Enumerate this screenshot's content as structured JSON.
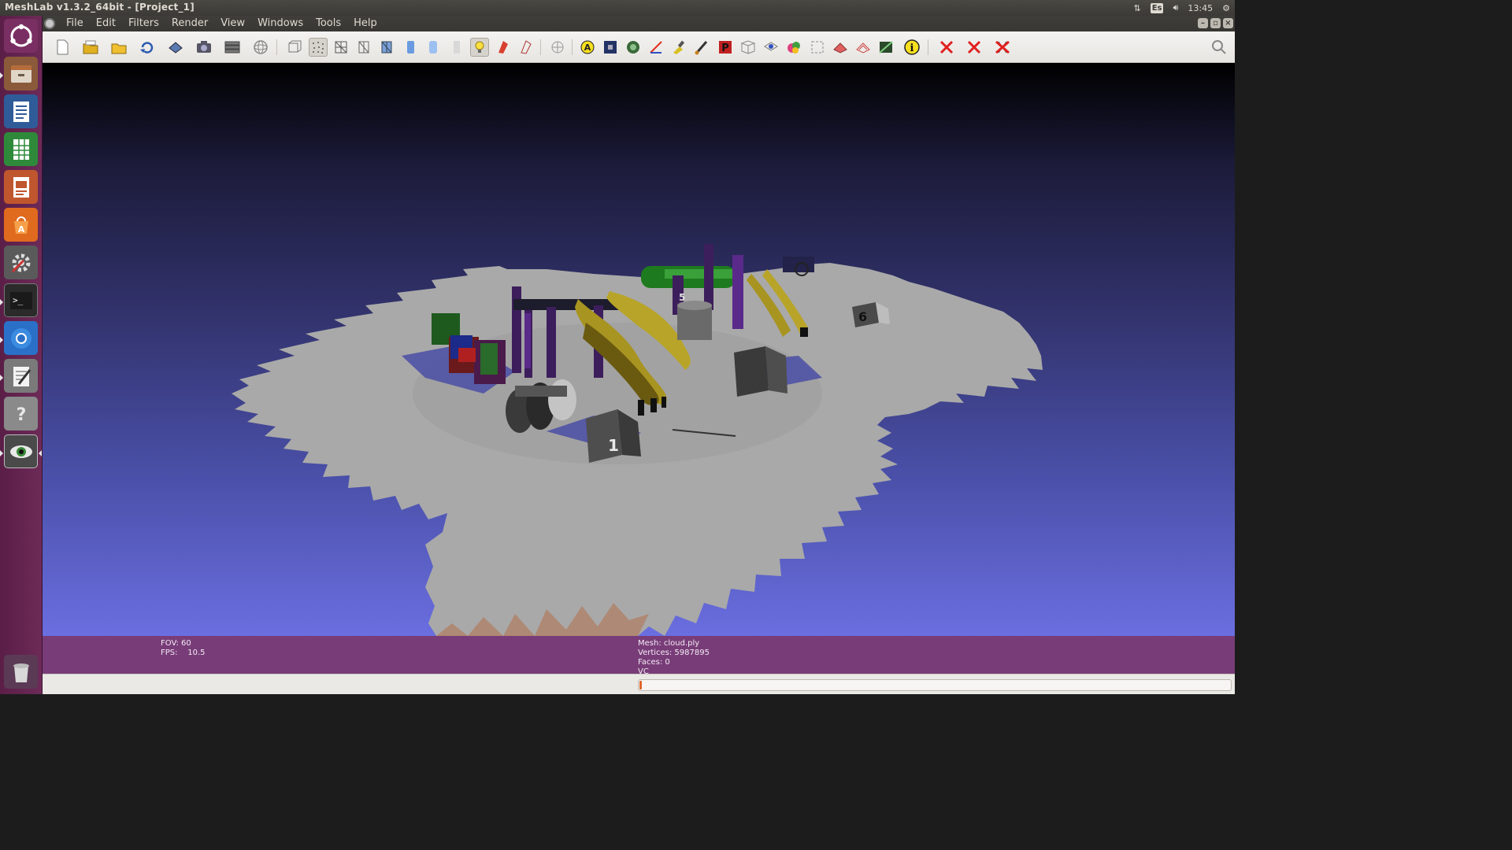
{
  "window": {
    "title": "MeshLab v1.3.2_64bit - [Project_1]"
  },
  "system_tray": {
    "keyboard_layout": "Es",
    "clock": "13:45"
  },
  "menu": {
    "items": [
      "File",
      "Edit",
      "Filters",
      "Render",
      "View",
      "Windows",
      "Tools",
      "Help"
    ]
  },
  "launcher": {
    "items": [
      {
        "name": "ubuntu-dash-icon",
        "active": false
      },
      {
        "name": "files-icon",
        "active": true
      },
      {
        "name": "libreoffice-writer-icon",
        "active": false
      },
      {
        "name": "libreoffice-calc-icon",
        "active": false
      },
      {
        "name": "libreoffice-impress-icon",
        "active": false
      },
      {
        "name": "software-center-icon",
        "active": false
      },
      {
        "name": "system-settings-icon",
        "active": false
      },
      {
        "name": "terminal-icon",
        "active": true
      },
      {
        "name": "chromium-icon",
        "active": true
      },
      {
        "name": "text-editor-icon",
        "active": true
      },
      {
        "name": "help-icon",
        "active": false
      },
      {
        "name": "meshlab-icon",
        "active": true
      },
      {
        "name": "trash-icon",
        "active": false
      }
    ]
  },
  "toolbar": {
    "buttons": [
      "new-project-icon",
      "open-project-icon",
      "open-mesh-icon",
      "reload-icon",
      "save-snapshot-icon",
      "snapshot-icon",
      "layers-icon",
      "trackball-icon",
      "bounding-box-icon",
      "points-icon",
      "wireframe-icon",
      "hidden-lines-icon",
      "flat-lines-icon",
      "flat-icon",
      "smooth-icon",
      "texture-icon",
      "light-icon",
      "double-light-icon",
      "backface-culling-icon",
      "axis-icon",
      "align-icon",
      "select-vertices-icon",
      "select-faces-icon",
      "measure-icon",
      "paint-icon",
      "brush-icon",
      "pickpoints-icon",
      "manipulator-icon",
      "select-connected-icon",
      "zbrush-icon",
      "reference-icon",
      "morph-icon",
      "fill-icon",
      "quality-icon",
      "texture-param-icon",
      "info-icon",
      "delete-vertices-icon",
      "delete-faces-icon",
      "delete-selection-icon"
    ]
  },
  "info": {
    "fov": "FOV: 60",
    "fps": "FPS:    10.5",
    "mesh": "Mesh: cloud.ply",
    "vertices": "Vertices: 5987895",
    "faces": "Faces: 0",
    "vc": "VC"
  },
  "progress": {
    "value": 0.004
  },
  "scene": {
    "marker_labels": [
      "1",
      "5",
      "6"
    ]
  }
}
